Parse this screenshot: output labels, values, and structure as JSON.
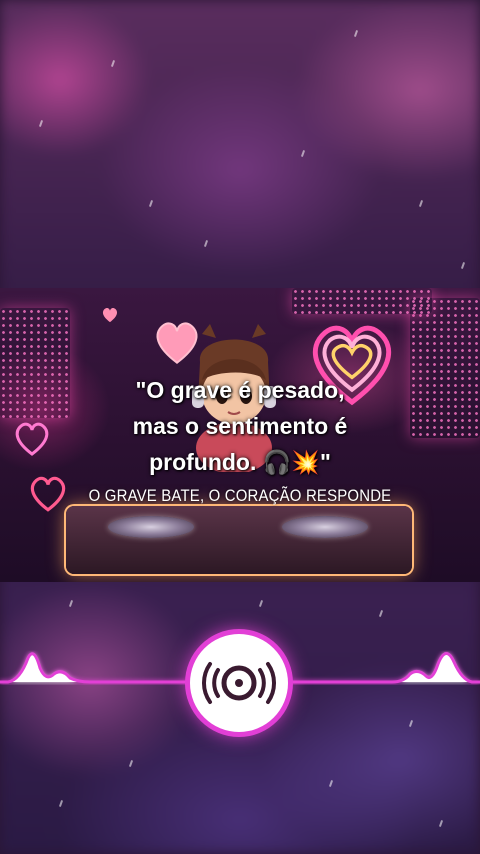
{
  "video": {
    "quote_line_1": "\"O grave é pesado,",
    "quote_line_2": "mas o sentimento é",
    "quote_line_3": "profundo. 🎧💥\"",
    "subtitle": "O GRAVE BATE, O CORAÇÃO RESPONDE"
  },
  "player": {
    "disc_icon": "vinyl-disc-icon",
    "accent_color": "#e23fd6"
  }
}
